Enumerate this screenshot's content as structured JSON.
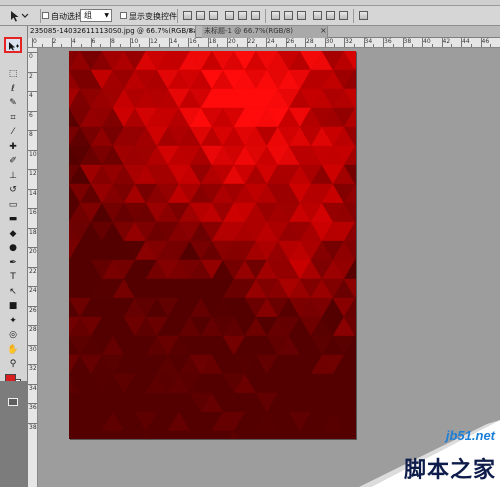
{
  "options_bar": {
    "auto_select_label": "自动选择:",
    "auto_select_value": "组",
    "show_transform_label": "显示变换控件"
  },
  "tabs": [
    {
      "label": "235085-140326111130S0.jpg @ 66.7%(RGB/8#)",
      "close": "×"
    },
    {
      "label": "未标题-1 @ 66.7%(RGB/8)",
      "close": "×"
    }
  ],
  "ruler": {
    "top_numbers": [
      "0",
      "2",
      "4",
      "6",
      "8",
      "10",
      "12",
      "14",
      "16",
      "18",
      "20",
      "22",
      "24",
      "26",
      "28",
      "30",
      "32",
      "34",
      "36",
      "38",
      "40",
      "42",
      "44",
      "46"
    ],
    "left_numbers": [
      "0",
      "2",
      "4",
      "6",
      "8",
      "10",
      "12",
      "14",
      "16",
      "18",
      "20",
      "22",
      "24",
      "26",
      "28",
      "30",
      "32",
      "34",
      "36",
      "38"
    ]
  },
  "tools": [
    {
      "name": "marquee-tool-icon",
      "glyph": "⬚"
    },
    {
      "name": "lasso-tool-icon",
      "glyph": "ℓ"
    },
    {
      "name": "quick-select-tool-icon",
      "glyph": "✎"
    },
    {
      "name": "crop-tool-icon",
      "glyph": "⌗"
    },
    {
      "name": "eyedropper-tool-icon",
      "glyph": "⁄"
    },
    {
      "name": "healing-brush-tool-icon",
      "glyph": "✚"
    },
    {
      "name": "brush-tool-icon",
      "glyph": "✐"
    },
    {
      "name": "clone-stamp-tool-icon",
      "glyph": "⊥"
    },
    {
      "name": "history-brush-tool-icon",
      "glyph": "↺"
    },
    {
      "name": "eraser-tool-icon",
      "glyph": "▭"
    },
    {
      "name": "gradient-tool-icon",
      "glyph": "▬"
    },
    {
      "name": "blur-tool-icon",
      "glyph": "◆"
    },
    {
      "name": "dodge-tool-icon",
      "glyph": "●"
    },
    {
      "name": "pen-tool-icon",
      "glyph": "✒"
    },
    {
      "name": "type-tool-icon",
      "glyph": "T"
    },
    {
      "name": "path-select-tool-icon",
      "glyph": "↖"
    },
    {
      "name": "shape-tool-icon",
      "glyph": "■"
    },
    {
      "name": "3d-rotate-tool-icon",
      "glyph": "✦"
    },
    {
      "name": "3d-orbit-tool-icon",
      "glyph": "◎"
    },
    {
      "name": "hand-tool-icon",
      "glyph": "✋"
    },
    {
      "name": "zoom-tool-icon",
      "glyph": "⚲"
    }
  ],
  "colors": {
    "foreground": "#d81e1e",
    "background": "#ffffff",
    "move_tool_highlight": "#e52323"
  },
  "watermark": {
    "url": "jb51.net",
    "title": "脚本之家"
  }
}
